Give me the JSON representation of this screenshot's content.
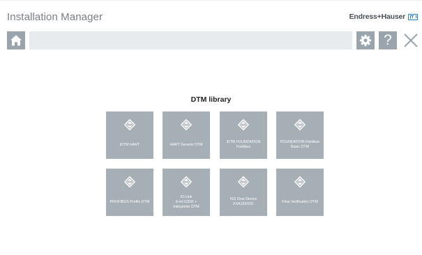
{
  "app": {
    "title": "Installation Manager",
    "brand": "Endress+Hauser"
  },
  "toolbar": {
    "home_icon": "home-icon",
    "search_value": "",
    "search_placeholder": "",
    "settings_icon": "gear-icon",
    "help_icon": "question-mark-icon",
    "help_glyph": "?",
    "close_icon": "close-icon"
  },
  "main": {
    "heading": "DTM library",
    "tiles": [
      {
        "label": "iDTM HART",
        "icon": "dtm-diamond-icon"
      },
      {
        "label": "HART Generic DTM",
        "icon": "dtm-diamond-icon"
      },
      {
        "label": "iDTM FOUNDATION\nFieldbus",
        "icon": "dtm-diamond-icon"
      },
      {
        "label": "FOUNDATION Fieldbus\nBasic DTM",
        "icon": "dtm-diamond-icon"
      },
      {
        "label": "PROFIBUS Profile DTM",
        "icon": "dtm-diamond-icon"
      },
      {
        "label": "IO-Link\nE+H IODD +\nInterpreter DTM",
        "icon": "dtm-diamond-icon"
      },
      {
        "label": "ISS Flow Device\nFXA193/291",
        "icon": "dtm-diamond-icon"
      },
      {
        "label": "Flow Verification DTM",
        "icon": "dtm-diamond-icon"
      }
    ]
  },
  "colors": {
    "tile_bg": "#a6aeb6",
    "toolbar_button_bg": "#9aa4ad",
    "search_bar_bg": "#e8ebee",
    "brand_blue": "#1d7fc3",
    "title_gray": "#7a7e82"
  }
}
